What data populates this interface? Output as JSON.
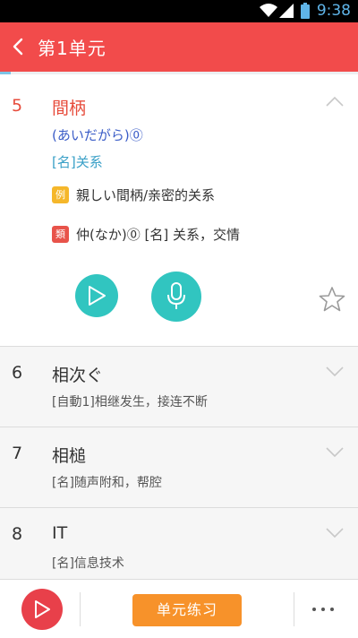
{
  "status_bar": {
    "time": "9:38"
  },
  "header": {
    "title": "第1单元"
  },
  "progress": {
    "fraction": 0.03
  },
  "expanded_word": {
    "number": "5",
    "word": "間柄",
    "reading": "(あいだがら)⓪",
    "meaning": "[名]关系",
    "example_tag": "例",
    "example": "親しい間柄/亲密的关系",
    "similar_tag": "類",
    "similar": "仲(なか)⓪ [名] 关系，交情"
  },
  "words": [
    {
      "number": "6",
      "word": "相次ぐ",
      "meaning": "[自動1]相继发生，接连不断"
    },
    {
      "number": "7",
      "word": "相槌",
      "meaning": "[名]随声附和，帮腔"
    },
    {
      "number": "8",
      "word": "IT",
      "meaning": "[名]信息技术"
    }
  ],
  "bottom_bar": {
    "practice_label": "单元练习"
  },
  "colors": {
    "header": "#f24b4b",
    "accent_red": "#e74c3c",
    "teal": "#31c5c0",
    "orange": "#f7922a",
    "reading_blue": "#3a5cc7",
    "meaning_blue": "#3aa0c7"
  }
}
